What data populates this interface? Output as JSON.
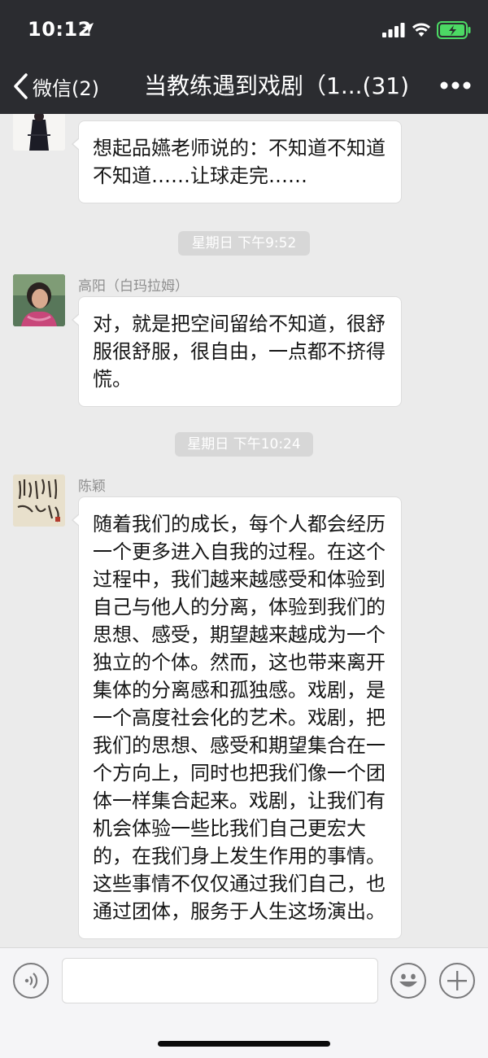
{
  "status_bar": {
    "time": "10:12"
  },
  "nav": {
    "back_label": "微信(2)",
    "title": "当教练遇到戏剧（1...(31)"
  },
  "messages": [
    {
      "sender": "",
      "text": "想起品嬿老师说的：不知道不知道不知道……让球走完……"
    },
    {
      "sender": "高阳（白玛拉姆）",
      "text": "对，就是把空间留给不知道，很舒服很舒服，很自由，一点都不挤得慌。"
    },
    {
      "sender": "陈颖",
      "text": "随着我们的成长，每个人都会经历一个更多进入自我的过程。在这个过程中，我们越来越感受和体验到自己与他人的分离，体验到我们的思想、感受，期望越来越成为一个独立的个体。然而，这也带来离开集体的分离感和孤独感。戏剧，是一个高度社会化的艺术。戏剧，把我们的思想、感受和期望集合在一个方向上，同时也把我们像一个团体一样集合起来。戏剧，让我们有机会体验一些比我们自己更宏大的，在我们身上发生作用的事情。这些事情不仅仅通过我们自己，也通过团体，服务于人生这场演出。"
    }
  ],
  "timestamps": [
    "星期日 下午9:52",
    "星期日 下午10:24"
  ],
  "input": {
    "value": ""
  },
  "colors": {
    "header_bg": "#2b2c30",
    "chat_bg": "#ebebeb",
    "battery_green": "#4cd964"
  }
}
